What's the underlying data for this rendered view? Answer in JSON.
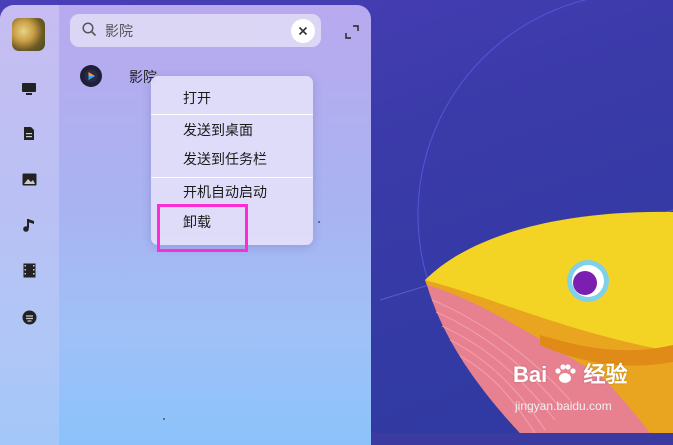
{
  "launcher": {
    "search": {
      "value": "影院",
      "placeholder": ""
    },
    "sidebar": {
      "items": [
        {
          "icon": "computer-icon"
        },
        {
          "icon": "document-icon"
        },
        {
          "icon": "picture-icon"
        },
        {
          "icon": "music-icon"
        },
        {
          "icon": "video-icon"
        },
        {
          "icon": "download-icon"
        }
      ]
    },
    "results": [
      {
        "name": "影院",
        "icon": "movie-player-icon"
      }
    ]
  },
  "context_menu": {
    "items": [
      {
        "label": "打开"
      },
      {
        "label": "发送到桌面"
      },
      {
        "label": "发送到任务栏"
      },
      {
        "label": "开机自动启动"
      },
      {
        "label": "卸载"
      }
    ],
    "highlighted_item": "卸载"
  },
  "watermark": {
    "brand_left": "Bai",
    "brand_right": "经验",
    "url": "jingyan.baidu.com"
  },
  "colors": {
    "highlight_border": "#ff2bd6",
    "fish_yellow": "#f3d324",
    "fish_eye_purple": "#7a1fb0"
  }
}
